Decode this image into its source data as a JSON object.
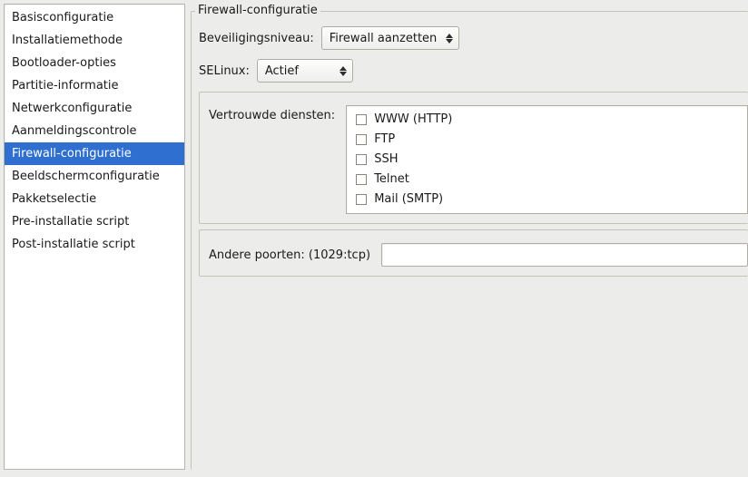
{
  "sidebar": {
    "items": [
      {
        "label": "Basisconfiguratie"
      },
      {
        "label": "Installatiemethode"
      },
      {
        "label": "Bootloader-opties"
      },
      {
        "label": "Partitie-informatie"
      },
      {
        "label": "Netwerkconfiguratie"
      },
      {
        "label": "Aanmeldingscontrole"
      },
      {
        "label": "Firewall-configuratie"
      },
      {
        "label": "Beeldschermconfiguratie"
      },
      {
        "label": "Pakketselectie"
      },
      {
        "label": "Pre-installatie script"
      },
      {
        "label": "Post-installatie script"
      }
    ],
    "selected_index": 6
  },
  "main": {
    "group_title": "Firewall-configuratie",
    "security_level": {
      "label": "Beveiligingsniveau:",
      "value": "Firewall aanzetten"
    },
    "selinux": {
      "label": "SELinux:",
      "value": "Actief"
    },
    "trusted": {
      "group_label": "Vertrouwde diensten:",
      "services": [
        {
          "label": "WWW (HTTP)",
          "checked": false
        },
        {
          "label": "FTP",
          "checked": false
        },
        {
          "label": "SSH",
          "checked": false
        },
        {
          "label": "Telnet",
          "checked": false
        },
        {
          "label": "Mail (SMTP)",
          "checked": false
        }
      ]
    },
    "other_ports": {
      "group_label": "Andere poorten: (1029:tcp)",
      "value": ""
    }
  }
}
